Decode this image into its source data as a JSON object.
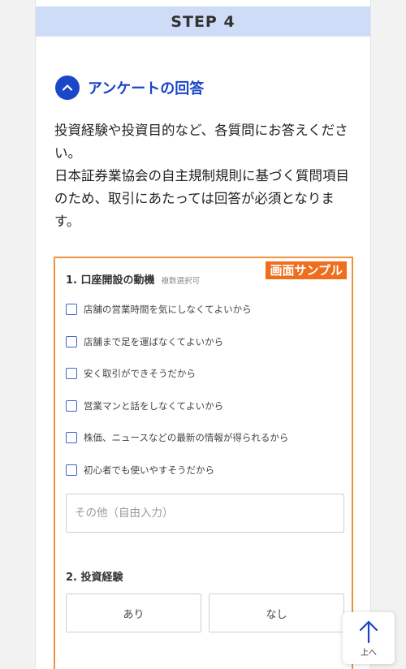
{
  "step": {
    "label": "STEP 4"
  },
  "section": {
    "title": "アンケートの回答"
  },
  "description": {
    "lines": [
      "投資経験や投資目的など、各質問にお答えください。",
      "日本証券業協会の自主規制規則に基づく質問項目のため、取引にあたっては回答が必須となります。"
    ]
  },
  "sample": {
    "badge": "画面サンプル",
    "q1": {
      "title": "1. 口座開設の動機",
      "note": "複数選択可",
      "options": [
        "店舗の営業時間を気にしなくてよいから",
        "店舗まで足を運ばなくてよいから",
        "安く取引ができそうだから",
        "営業マンと話をしなくてよいから",
        "株価、ニュースなどの最新の情報が得られるから",
        "初心者でも使いやすそうだから"
      ],
      "free_placeholder": "その他（自由入力）"
    },
    "q2": {
      "title": "2. 投資経験",
      "yes_label": "あり",
      "no_label": "なし"
    }
  },
  "to_top": {
    "label": "上へ",
    "icon": "arrow-up-icon"
  },
  "colors": {
    "accent": "#1a46c8",
    "step_bg": "#cfdcf8",
    "sample_border": "#f2913d",
    "badge_bg": "#ee6e1e",
    "checkbox": "#3f66c9"
  }
}
